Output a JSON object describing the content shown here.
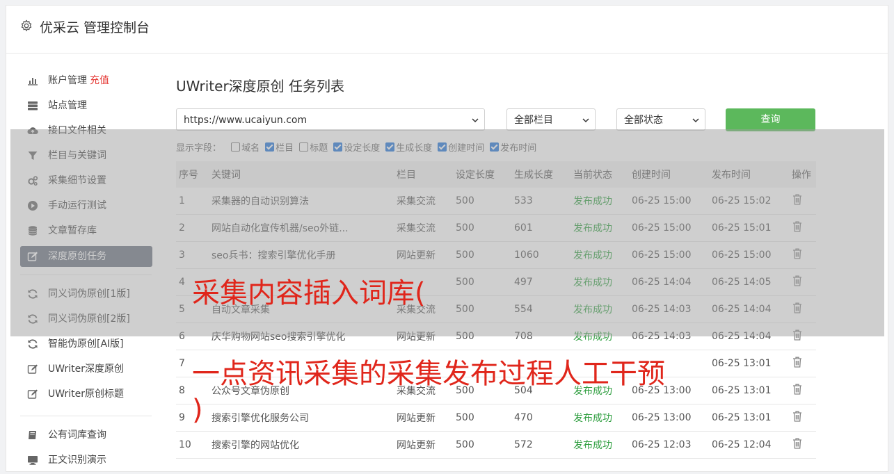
{
  "header": {
    "title": "优采云 管理控制台"
  },
  "sidebar": {
    "recharge": "充值",
    "group1": [
      {
        "label": "账户管理",
        "icon": "bar-chart-icon"
      },
      {
        "label": "站点管理",
        "icon": "server-icon"
      },
      {
        "label": "接口文件相关",
        "icon": "cloud-upload-icon"
      },
      {
        "label": "栏目与关键词",
        "icon": "filter-icon"
      },
      {
        "label": "采集细节设置",
        "icon": "gears-icon"
      },
      {
        "label": "手动运行测试",
        "icon": "play-icon"
      },
      {
        "label": "文章暂存库",
        "icon": "database-icon"
      },
      {
        "label": "深度原创任务",
        "icon": "edit-icon"
      }
    ],
    "group2": [
      {
        "label": "同义词伪原创[1版]",
        "icon": "refresh-icon"
      },
      {
        "label": "同义词伪原创[2版]",
        "icon": "refresh-icon"
      },
      {
        "label": "智能伪原创[AI版]",
        "icon": "refresh-icon"
      },
      {
        "label": "UWriter深度原创",
        "icon": "edit-icon"
      },
      {
        "label": "UWriter原创标题",
        "icon": "edit-icon"
      }
    ],
    "group3": [
      {
        "label": "公有词库查询",
        "icon": "book-icon"
      },
      {
        "label": "正文识别演示",
        "icon": "monitor-icon"
      }
    ]
  },
  "main": {
    "title": "UWriter深度原创 任务列表",
    "site_select": "https://www.ucaiyun.com",
    "column_select": "全部栏目",
    "status_select": "全部状态",
    "query_button": "查询",
    "fields_label": "显示字段：",
    "fields": [
      {
        "label": "域名",
        "checked": false
      },
      {
        "label": "栏目",
        "checked": true
      },
      {
        "label": "标题",
        "checked": false
      },
      {
        "label": "设定长度",
        "checked": true
      },
      {
        "label": "生成长度",
        "checked": true
      },
      {
        "label": "创建时间",
        "checked": true
      },
      {
        "label": "发布时间",
        "checked": true
      }
    ],
    "table": {
      "headers": [
        "序号",
        "关键词",
        "栏目",
        "设定长度",
        "生成长度",
        "当前状态",
        "创建时间",
        "发布时间",
        "操作"
      ],
      "rows": [
        [
          "1",
          "采集器的自动识别算法",
          "采集交流",
          "500",
          "533",
          "发布成功",
          "06-25 15:00",
          "06-25 15:02"
        ],
        [
          "2",
          "网站自动化宣传机器/seo外链...",
          "采集交流",
          "500",
          "601",
          "发布成功",
          "06-25 15:00",
          "06-25 15:01"
        ],
        [
          "3",
          "seo兵书：搜索引擎优化手册",
          "网站更新",
          "500",
          "1060",
          "发布成功",
          "06-25 15:00",
          "06-25 15:00"
        ],
        [
          "4",
          "",
          "",
          "500",
          "497",
          "发布成功",
          "06-25 14:04",
          "06-25 14:05"
        ],
        [
          "5",
          "自动文章采集",
          "采集交流",
          "500",
          "554",
          "发布成功",
          "06-25 14:03",
          "06-25 14:04"
        ],
        [
          "6",
          "庆华购物网站seo搜索引擎优化",
          "网站更新",
          "500",
          "708",
          "发布成功",
          "06-25 14:03",
          "06-25 14:04"
        ],
        [
          "7",
          "",
          "",
          "",
          "",
          "",
          "",
          "06-25 13:01"
        ],
        [
          "8",
          "公众号文章伪原创",
          "采集交流",
          "500",
          "504",
          "发布成功",
          "06-25 13:00",
          "06-25 13:01"
        ],
        [
          "9",
          "搜索引擎优化服务公司",
          "网站更新",
          "500",
          "470",
          "发布成功",
          "06-25 13:00",
          "06-25 13:01"
        ],
        [
          "10",
          "搜索引擎的网站优化",
          "网站更新",
          "500",
          "572",
          "发布成功",
          "06-25 12:03",
          "06-25 12:04"
        ]
      ]
    }
  },
  "overlay": {
    "line1": "采集内容插入词库(",
    "line2": "一点资讯采集的采集发布过程人工干预",
    "line3": ")"
  }
}
